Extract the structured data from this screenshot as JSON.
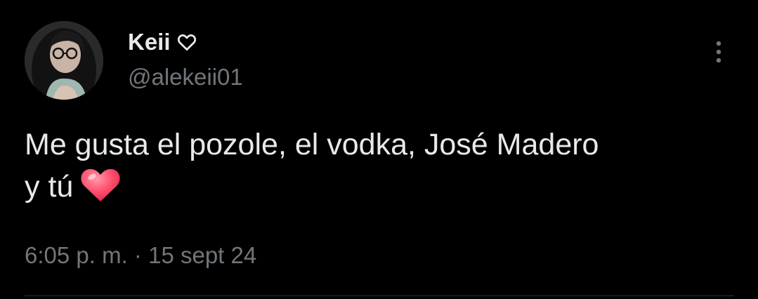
{
  "tweet": {
    "author": {
      "display_name": "Keii",
      "name_badge_icon": "heart-outline-icon",
      "handle": "@alekeii01"
    },
    "text_line1": "Me gusta el pozole, el vodka, José Madero",
    "text_line2": "y tú",
    "emoji": "red-heart-emoji",
    "time": "6:05 p. m.",
    "separator": "·",
    "date": "15 sept 24",
    "more_icon": "more-options-icon"
  },
  "colors": {
    "background": "#000000",
    "primary_text": "#e7e9ea",
    "secondary_text": "#71767b",
    "divider": "#2f3336",
    "heart": "#ff4d6d"
  }
}
